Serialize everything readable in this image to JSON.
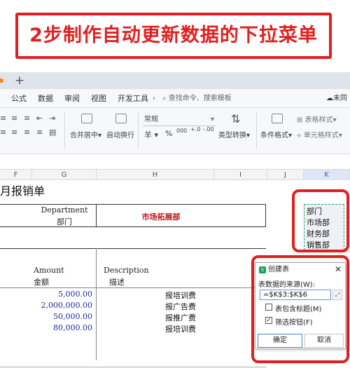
{
  "banner": {
    "title": "2步制作自动更新数据的下拉菜单"
  },
  "tabs": {
    "add_icon": "plus-icon"
  },
  "menu": {
    "items": [
      "公式",
      "数据",
      "审阅",
      "视图",
      "开发工具"
    ],
    "more": "›",
    "search": "查找命令、搜索模板",
    "cloud": "未同"
  },
  "ribbon": {
    "merge_label": "合并居中",
    "wrap_label": "自动换行",
    "format_dropdown": "常规",
    "currency_symbol": "羊",
    "percent_symbol": "%",
    "thousands_symbol": "000",
    "dec_inc": "+.0",
    "dec_dec": "-.00",
    "type_convert": "类型转换",
    "cond_format": "条件格式",
    "table_style": "表格样式",
    "cell_style": "单元格样式"
  },
  "columns": [
    "F",
    "G",
    "H",
    "I",
    "J",
    "K"
  ],
  "sheet": {
    "title_fragment": "月报销单",
    "dept_label_en": "Department",
    "dept_label_cn": "部门",
    "dept_value": "市场拓展部",
    "amount_en": "Amount",
    "amount_cn": "金额",
    "desc_en": "Description",
    "desc_cn": "描述",
    "amounts": [
      "5,000.00",
      "2,000,000.00",
      "50,000.00",
      "80,000.00"
    ],
    "descriptions": [
      "报培训费",
      "报广告费",
      "报推广费",
      "报培训费"
    ]
  },
  "dropdown_source": {
    "items": [
      "部门",
      "市场部",
      "财务部",
      "销售部"
    ]
  },
  "dialog": {
    "title": "创建表",
    "source_label": "表数据的来源(W):",
    "source_value": "=$K$3:$K$6",
    "pick_icon": "range-picker-icon",
    "has_header_label": "表包含标题(M)",
    "has_header_checked": false,
    "filter_label": "筛选按钮(F)",
    "filter_checked": true,
    "ok_label": "确定",
    "cancel_label": "取消"
  },
  "colors": {
    "highlight": "#e02020",
    "amount_text": "#1a2ba0",
    "dept_value": "#c0141e"
  }
}
